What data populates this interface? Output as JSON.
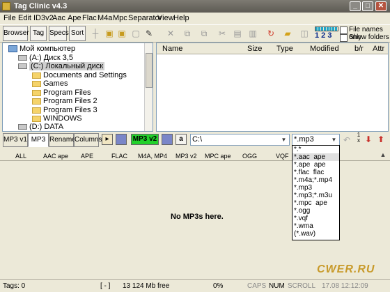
{
  "window": {
    "title": "Tag Clinic v4.3",
    "min": "_",
    "max": "□",
    "close": "✕"
  },
  "menu": [
    "File",
    "Edit",
    "ID3v2",
    "Aac",
    "Ape",
    "Flac",
    "M4a",
    "Mpc",
    "Separator",
    "View",
    "Help"
  ],
  "toolbar": {
    "browser": "Browser",
    "tag": "Tag",
    "specs": "Specs",
    "sort": "Sort",
    "page_numbers": "1 2 3",
    "file_names_only": "File names only",
    "show_folders": "Show folders"
  },
  "tree": {
    "items": [
      "Мой компьютер",
      "(A:) Диск 3,5",
      "(C:) Локальный диск",
      "Documents and Settings",
      "Games",
      "Program Files",
      "Program Files 2",
      "Program Files 3",
      "WINDOWS",
      "(D:) DATA"
    ]
  },
  "filelist": {
    "columns": [
      "Name",
      "Size",
      "Type",
      "Modified",
      "b/r",
      "Attr"
    ]
  },
  "tabs": {
    "mp3v1": "MP3 v1",
    "mp3": "MP3",
    "rename": "Rename",
    "columns": "Columns"
  },
  "mid": {
    "mp3v2": "MP3 v2",
    "a": "a",
    "path": "C:\\",
    "filter": "*.mp3"
  },
  "dropdown": {
    "options": [
      "*.*",
      "*.aac  ape",
      "*.ape  ape",
      "*.flac  flac",
      "*.m4a;*.mp4",
      "*.mp3",
      "*.mp3;*.m3u",
      "*.mpc  ape",
      "*.ogg",
      "*.vqf",
      "*.wma",
      "(*.wav)"
    ]
  },
  "tag_columns": [
    "ALL",
    "AAC ape",
    "APE",
    "FLAC",
    "M4A, MP4",
    "MP3 v2",
    "MPC ape",
    "OGG",
    "VQF"
  ],
  "main": {
    "message": "No MP3s here."
  },
  "status": {
    "tags": "Tags: 0",
    "bracket": "[  -  ]",
    "free": "13 124 Mb free",
    "percent": "0%",
    "caps": "CAPS",
    "num": "NUM",
    "scroll": "SCROLL",
    "time": "17.08 12:12:09"
  },
  "watermark": "CWER.RU",
  "colors": {
    "accent_green": "#22d12a",
    "selection": "#cfcfcf",
    "title_bg": "#6b6860"
  }
}
